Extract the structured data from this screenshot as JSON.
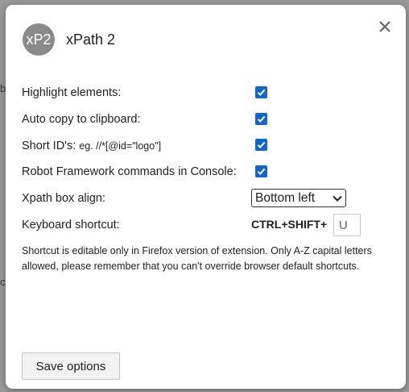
{
  "dialog": {
    "logo_text": "xP2",
    "title": "xPath 2",
    "close_icon": "close-icon"
  },
  "options": {
    "highlight": {
      "label": "Highlight elements:",
      "checked": true
    },
    "auto_copy": {
      "label": "Auto copy to clipboard:",
      "checked": true
    },
    "short_ids": {
      "label": "Short ID's:",
      "example": "eg. //*[@id=\"logo\"]",
      "checked": true
    },
    "robot": {
      "label": "Robot Framework commands in Console:",
      "checked": true
    },
    "xpath_align": {
      "label": "Xpath box align:",
      "selected": "Bottom left"
    },
    "shortcut": {
      "label": "Keyboard shortcut:",
      "combo_prefix": "CTRL+SHIFT+",
      "key_value": "U"
    }
  },
  "note": "Shortcut is editable only in Firefox version of extension. Only A-Z capital letters allowed, please remember that you can't override browser default shortcuts.",
  "save_label": "Save options",
  "colors": {
    "checkbox": "#0b66d6",
    "logo_bg": "#8a8a8a",
    "overlay": "#9a9a9a"
  }
}
